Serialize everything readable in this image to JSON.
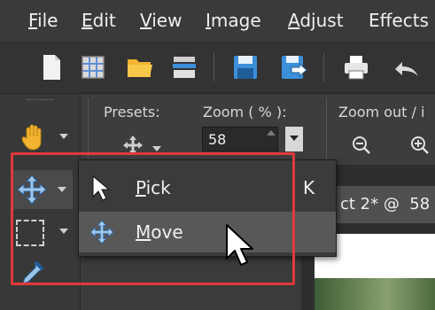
{
  "menubar": {
    "items": [
      {
        "accel": "F",
        "rest": "ile"
      },
      {
        "accel": "E",
        "rest": "dit"
      },
      {
        "accel": "V",
        "rest": "iew"
      },
      {
        "accel": "I",
        "rest": "mage"
      },
      {
        "accel": "A",
        "rest": "djust"
      },
      {
        "accel": "",
        "rest": "Effects"
      }
    ]
  },
  "toolbar": {
    "icons": [
      "new-document-icon",
      "grid-icon",
      "open-folder-icon",
      "scan-icon",
      "save-icon",
      "save-as-icon",
      "print-icon",
      "undo-icon"
    ]
  },
  "options": {
    "presets_label": "Presets:",
    "zoom_label": "Zoom ( % ):",
    "zoom_value": "58",
    "zoom_out_label": "Zoom out / i"
  },
  "document": {
    "tab_title": "ct 2* @  58"
  },
  "flyout": {
    "pick": {
      "accel": "P",
      "rest": "ick",
      "shortcut": "K"
    },
    "move": {
      "accel": "M",
      "rest": "ove",
      "shortcut": ""
    }
  },
  "colors": {
    "highlight": "#e1393b",
    "selected_row": "#585858"
  }
}
